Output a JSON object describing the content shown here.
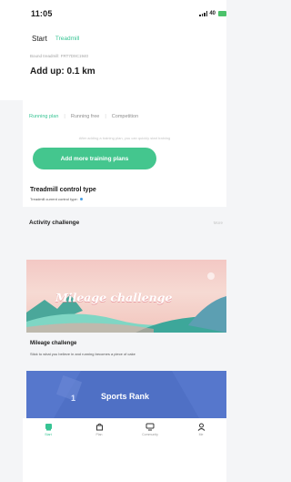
{
  "status_bar": {
    "time": "11:05",
    "network": "40"
  },
  "top_tabs": {
    "start": "Start",
    "treadmill": "Treadmill"
  },
  "hero": {
    "bound": "Bound treadmill: FRT7D9C1940",
    "add_up": "Add up: 0.1 km"
  },
  "plans": {
    "tabs": [
      "Running plan",
      "Running free",
      "Competition"
    ],
    "hint": "After adding a training plan, you can quickly start training",
    "add_button": "Add more training plans"
  },
  "control": {
    "title": "Treadmill control type",
    "subtitle": "Treadmill current control type:"
  },
  "challenge": {
    "title": "Activity challenge",
    "more": "More",
    "banner_text": "Mileage challenge",
    "card_title": "Mileage challenge",
    "card_sub": "Stick to what you believe in and running becomes a piece of cake"
  },
  "rank": {
    "number": "1",
    "label": "Sports Rank"
  },
  "tabbar": {
    "items": [
      {
        "label": "Start",
        "icon": "running-icon"
      },
      {
        "label": "Plan",
        "icon": "bag-icon"
      },
      {
        "label": "Community",
        "icon": "community-icon"
      },
      {
        "label": "Me",
        "icon": "person-icon"
      }
    ]
  },
  "colors": {
    "accent": "#37c494",
    "button": "#44c68e",
    "rank_bg": "#4f70c5"
  }
}
